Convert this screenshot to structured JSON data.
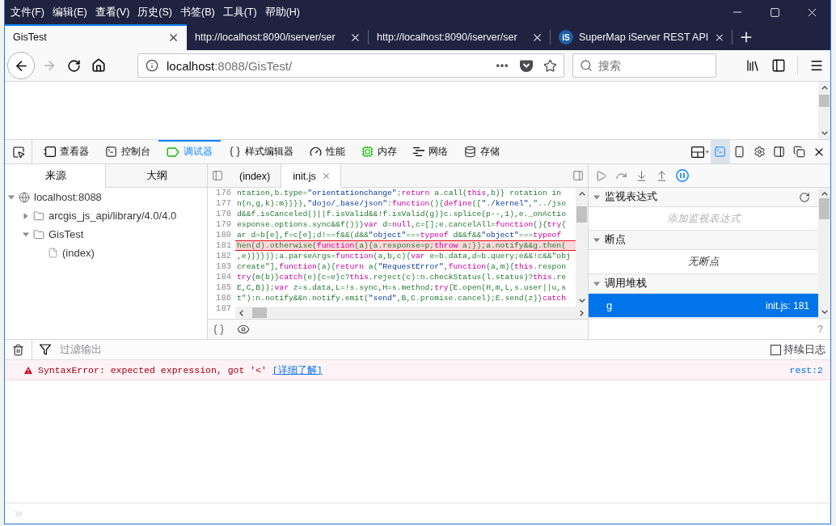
{
  "window": {
    "menu": [
      "文件(F)",
      "编辑(E)",
      "查看(V)",
      "历史(S)",
      "书签(B)",
      "工具(T)",
      "帮助(H)"
    ]
  },
  "browser_tabs": [
    {
      "title": "GisTest",
      "selected": true
    },
    {
      "title": "http://localhost:8090/iserver/ser",
      "selected": false
    },
    {
      "title": "http://localhost:8090/iserver/ser",
      "selected": false
    },
    {
      "title": "SuperMap iServer REST API",
      "selected": false,
      "logo": "iS"
    }
  ],
  "navigation": {
    "back_disabled": false,
    "forward_disabled": true,
    "url_host": "localhost",
    "url_path": ":8088/GisTest/",
    "search_placeholder": "搜索"
  },
  "devtools": {
    "tools": [
      {
        "label": "查看器",
        "kind": "inspector",
        "selected": false
      },
      {
        "label": "控制台",
        "kind": "console",
        "selected": false
      },
      {
        "label": "调试器",
        "kind": "debugger",
        "selected": true
      },
      {
        "label": "样式编辑器",
        "kind": "style",
        "selected": false
      },
      {
        "label": "性能",
        "kind": "performance",
        "selected": false
      },
      {
        "label": "内存",
        "kind": "memory",
        "selected": false
      },
      {
        "label": "网络",
        "kind": "network",
        "selected": false
      },
      {
        "label": "存储",
        "kind": "storage",
        "selected": false
      }
    ],
    "split_console": true
  },
  "sources": {
    "tabs": [
      {
        "label": "来源",
        "selected": true
      },
      {
        "label": "大纲",
        "selected": false
      }
    ],
    "tree": [
      {
        "label": "localhost:8088",
        "kind": "host",
        "expanded": true,
        "children": [
          {
            "label": "arcgis_js_api/library/4.0/4.0",
            "kind": "folder",
            "expanded": false
          },
          {
            "label": "GisTest",
            "kind": "folder",
            "expanded": true,
            "children": [
              {
                "label": "(index)",
                "kind": "file"
              }
            ]
          }
        ]
      }
    ]
  },
  "editor": {
    "tabs": [
      {
        "label": "(index)",
        "selected": false
      },
      {
        "label": "init.js",
        "selected": true
      }
    ],
    "lines": [
      {
        "number": "176",
        "text": "ntation,b.type=\"orientationchange\";return a.call(this,b)} rotation in",
        "paused": false
      },
      {
        "number": "177",
        "text": "n(n,g,k):m}}}),\"dojo/_base/json\":function(){define([\"./kernel\",\"../jso",
        "paused": false
      },
      {
        "number": "178",
        "text": "d&&f.isCanceled()||f.isValid&&!f.isValid(g))c.splice(p--,1),e._onActio",
        "paused": false
      },
      {
        "number": "179",
        "text": "esponse.options.sync&&f())}var d=null,c=[];e.cancelAll=function(){try{",
        "paused": false
      },
      {
        "number": "180",
        "text": "ar d=b[e],f=c[e];d!==f&&(d&&\"object\"===typeof d&&f&&\"object\"===typeof",
        "paused": false
      },
      {
        "number": "181",
        "text": "hen(d).otherwise(function(a){a.response=p;throw a;});a.notify&&g.then(",
        "paused": true
      },
      {
        "number": "182",
        "text": ",e)}}})};a.parseArgs=function(a,b,c){var e=b.data,d=b.query;e&&!c&&\"obj",
        "paused": false
      },
      {
        "number": "183",
        "text": "create\"],function(a){return a(\"RequestError\",function(a,m){this.respon",
        "paused": false
      },
      {
        "number": "184",
        "text": "try{m(b)}catch(e){c=e}c?this.reject(c):n.checkStatus(l.status)?this.re",
        "paused": false
      },
      {
        "number": "185",
        "text": "E,C,B));var z=s.data,L=!s.sync,H=s.method;try{E.open(H,m,L,s.user||u,s",
        "paused": false
      },
      {
        "number": "186",
        "text": "t\"):n.notify&&n.notify.emit(\"send\",B,C.promise.cancel);E.send(z)}catch",
        "paused": false
      },
      {
        "number": "187",
        "paused": false
      }
    ]
  },
  "side_panel": {
    "sections": [
      {
        "kind": "watch",
        "title": "监视表达式",
        "expanded": true,
        "placeholder": "添加监视表达式"
      },
      {
        "kind": "breakpoints",
        "title": "断点",
        "expanded": true,
        "empty_text": "无断点"
      },
      {
        "kind": "call_stack",
        "title": "调用堆栈",
        "expanded": true,
        "frames": [
          {
            "name": "g",
            "location": "init.js: 181",
            "selected": true
          }
        ]
      }
    ],
    "help": "?"
  },
  "console": {
    "filter_placeholder": "过滤输出",
    "persist_logs": {
      "label": "持续日志",
      "checked": false
    },
    "messages": [
      {
        "kind": "error",
        "text": "SyntaxError: expected expression, got '<'",
        "link": "[详细了解]",
        "source": "rest:2"
      }
    ]
  }
}
